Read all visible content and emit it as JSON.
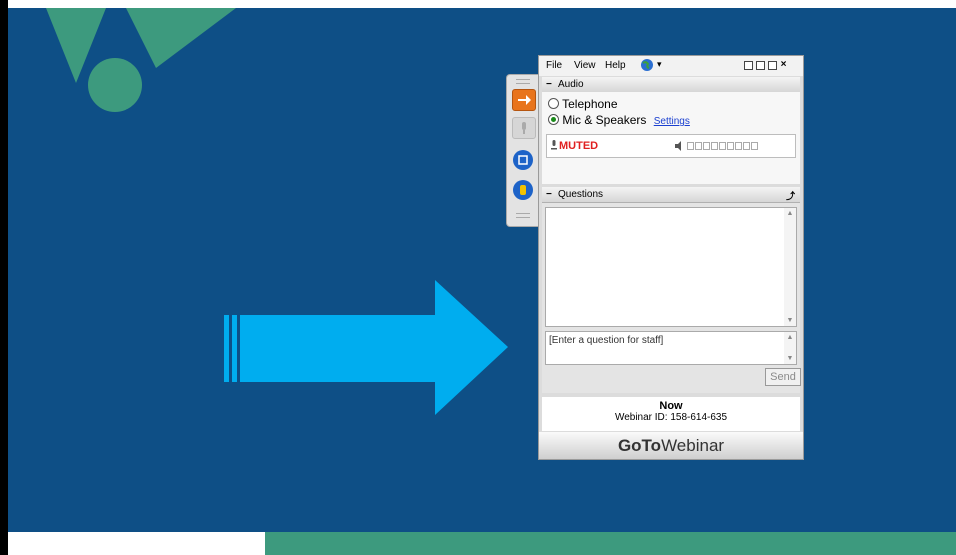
{
  "menu": {
    "file": "File",
    "view": "View",
    "help": "Help",
    "globe_icon": "globe-icon",
    "globe_dropdown": "▾"
  },
  "audio": {
    "section_title": "Audio",
    "collapse_symbol": "−",
    "option_telephone": "Telephone",
    "option_mic": "Mic & Speakers",
    "selected": "Mic & Speakers",
    "settings_link": "Settings",
    "muted_label": "MUTED",
    "muted_color": "#e02020"
  },
  "questions": {
    "section_title": "Questions",
    "collapse_symbol": "−",
    "input_placeholder": "[Enter a question for staff]",
    "send_label": "Send"
  },
  "session": {
    "status": "Now",
    "webinar_id": "Webinar ID: 158-614-635"
  },
  "brand": {
    "bold": "GoTo",
    "light": "Webinar"
  },
  "colors": {
    "slide_background": "#0e4f86",
    "arrow": "#00adef",
    "logo_green": "#3d9a7e",
    "footer_green": "#3d9a7e",
    "toolbar_orange": "#e8741c",
    "link_blue": "#1a3fd0"
  }
}
